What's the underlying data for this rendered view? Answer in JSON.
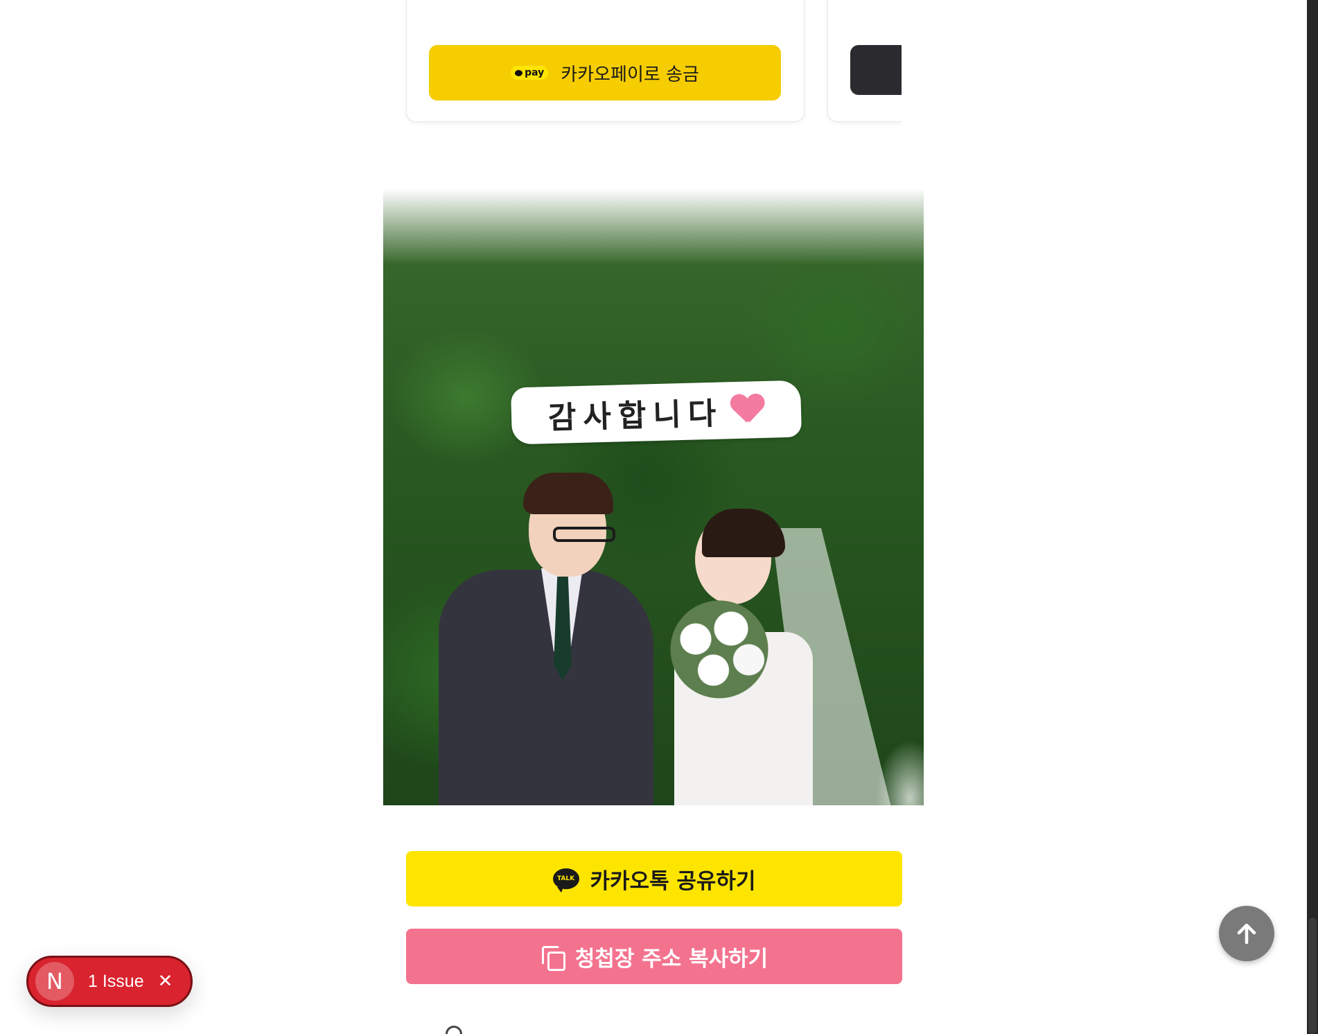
{
  "account_cards": {
    "kakaopay_badge": "pay",
    "kakaopay_label": "카카오페이로 송금"
  },
  "photo": {
    "banner_text": "감사합니다"
  },
  "actions": {
    "kakao_share_icon": "TALK",
    "kakao_share_label": "카카오톡 공유하기",
    "copy_link_label": "청첩장 주소 복사하기"
  },
  "dev_overlay": {
    "logo": "N",
    "issue_label": "1 Issue",
    "close": "✕"
  },
  "colors": {
    "kakaopay_yellow": "#f5cd00",
    "kakao_yellow": "#fee500",
    "copy_pink": "#f3738f",
    "issue_red": "#d9232f"
  },
  "icons": [
    "kakaopay-icon",
    "heart-icon",
    "kakaotalk-icon",
    "copy-icon",
    "arrow-up-icon",
    "close-icon"
  ]
}
